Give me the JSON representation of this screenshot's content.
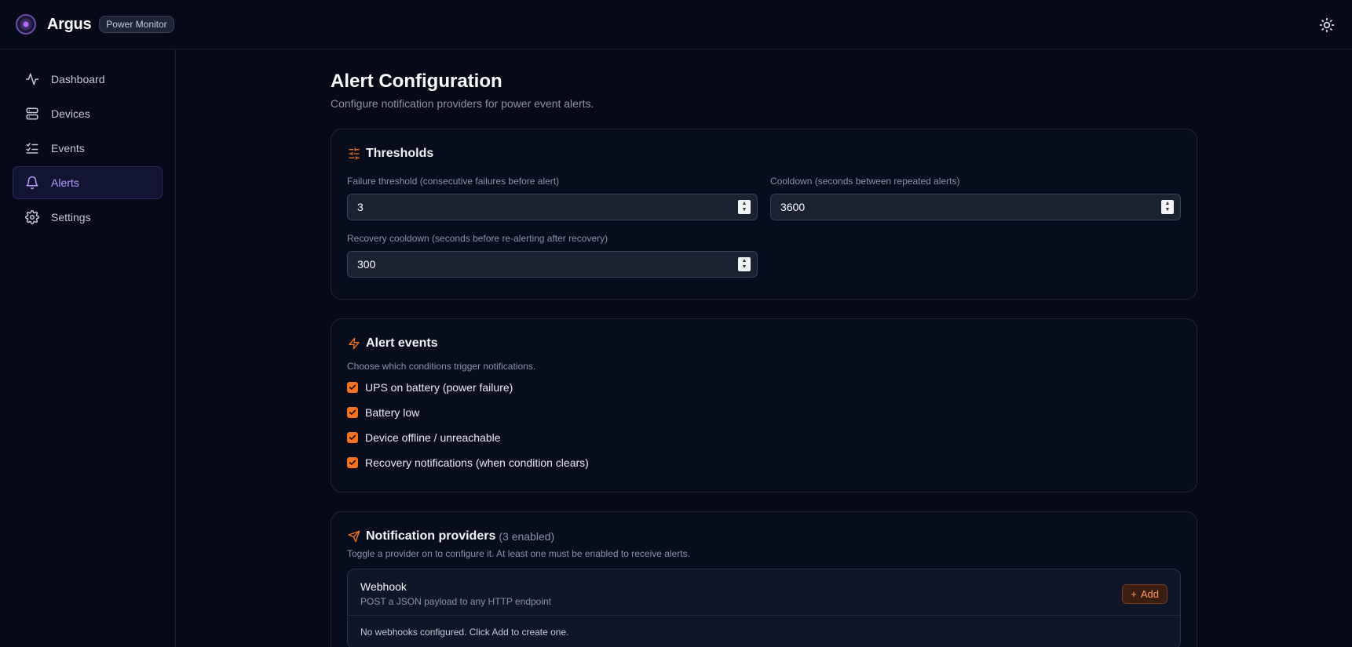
{
  "app": {
    "name": "Argus",
    "badge": "Power Monitor"
  },
  "sidebar": {
    "items": [
      {
        "label": "Dashboard",
        "icon": "activity-icon"
      },
      {
        "label": "Devices",
        "icon": "server-icon"
      },
      {
        "label": "Events",
        "icon": "list-checks-icon"
      },
      {
        "label": "Alerts",
        "icon": "bell-icon",
        "active": true
      },
      {
        "label": "Settings",
        "icon": "gear-icon"
      }
    ]
  },
  "page": {
    "title": "Alert Configuration",
    "subtitle": "Configure notification providers for power event alerts."
  },
  "thresholds": {
    "title": "Thresholds",
    "failure_label": "Failure threshold (consecutive failures before alert)",
    "failure_value": "3",
    "cooldown_label": "Cooldown (seconds between repeated alerts)",
    "cooldown_value": "3600",
    "recovery_label": "Recovery cooldown (seconds before re-alerting after recovery)",
    "recovery_value": "300"
  },
  "alert_events": {
    "title": "Alert events",
    "description": "Choose which conditions trigger notifications.",
    "items": [
      {
        "label": "UPS on battery (power failure)",
        "checked": true
      },
      {
        "label": "Battery low",
        "checked": true
      },
      {
        "label": "Device offline / unreachable",
        "checked": true
      },
      {
        "label": "Recovery notifications (when condition clears)",
        "checked": true
      }
    ]
  },
  "providers": {
    "title": "Notification providers",
    "count_text": "(3 enabled)",
    "description": "Toggle a provider on to configure it. At least one must be enabled to receive alerts.",
    "webhook": {
      "name": "Webhook",
      "description": "POST a JSON payload to any HTTP endpoint",
      "add_label": "Add",
      "empty_text": "No webhooks configured. Click Add to create one."
    }
  },
  "colors": {
    "accent": "#f5711c",
    "active_nav": "#b79cff",
    "background": "#060a18"
  }
}
